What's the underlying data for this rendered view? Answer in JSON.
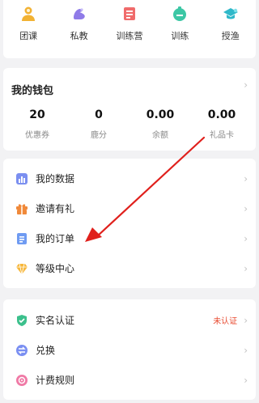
{
  "services": [
    {
      "label": "团课",
      "icon": "group-class-icon"
    },
    {
      "label": "私教",
      "icon": "personal-trainer-icon"
    },
    {
      "label": "训练营",
      "icon": "training-camp-icon"
    },
    {
      "label": "训练",
      "icon": "training-icon"
    },
    {
      "label": "授渔",
      "icon": "teaching-icon"
    }
  ],
  "wallet": {
    "title": "我的钱包",
    "stats": [
      {
        "value": "20",
        "label": "优惠券"
      },
      {
        "value": "0",
        "label": "鹿分"
      },
      {
        "value": "0.00",
        "label": "余额"
      },
      {
        "value": "0.00",
        "label": "礼品卡"
      }
    ]
  },
  "menu1": [
    {
      "label": "我的数据",
      "icon": "data-chart-icon"
    },
    {
      "label": "邀请有礼",
      "icon": "gift-icon"
    },
    {
      "label": "我的订单",
      "icon": "order-icon"
    },
    {
      "label": "等级中心",
      "icon": "diamond-icon"
    }
  ],
  "menu2": [
    {
      "label": "实名认证",
      "icon": "shield-check-icon",
      "tag": "未认证"
    },
    {
      "label": "兑换",
      "icon": "exchange-icon"
    },
    {
      "label": "计费规则",
      "icon": "billing-rules-icon"
    }
  ],
  "chevron": "›",
  "colors": {
    "annotation_arrow": "#e0201c",
    "unverified_tag": "#e8492f"
  }
}
